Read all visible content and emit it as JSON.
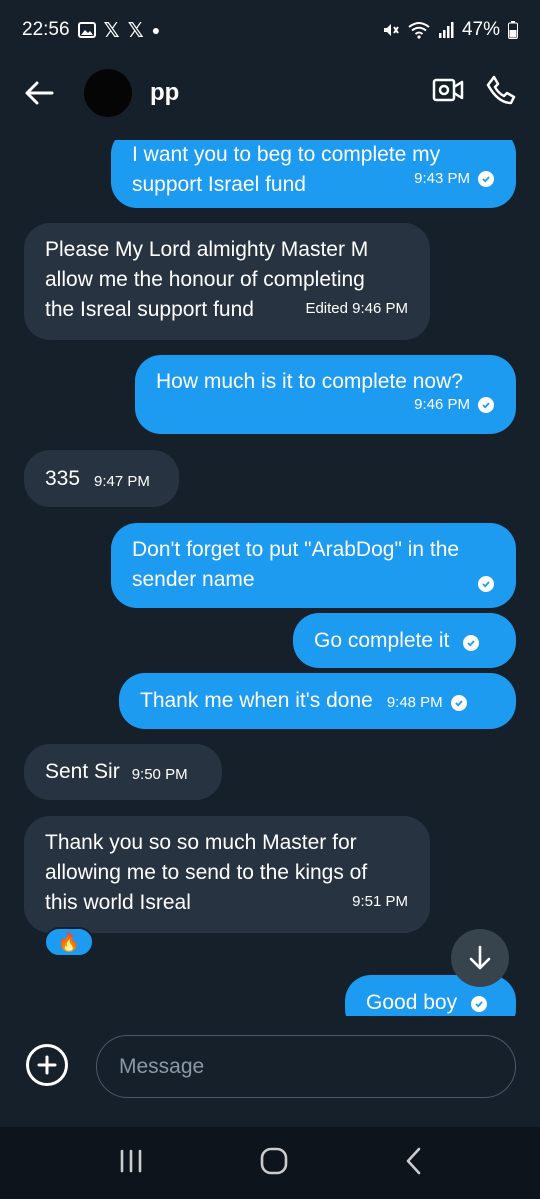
{
  "status_bar": {
    "time": "22:56",
    "battery": "47%",
    "icons": [
      "image-icon",
      "x-logo",
      "x-logo",
      "dot",
      "mute-icon",
      "wifi-icon",
      "signal-icon",
      "battery-icon"
    ]
  },
  "header": {
    "title": "pp",
    "icons": [
      "back-arrow-icon",
      "video-call-icon",
      "phone-icon"
    ]
  },
  "messages": [
    {
      "dir": "out",
      "text_lines": [
        "I want you to beg to complete my",
        "support Israel fund"
      ],
      "time": "9:43 PM",
      "read": true
    },
    {
      "dir": "in",
      "text_lines": [
        "Please My Lord almighty Master M",
        "allow me the honour of completing",
        "the Isreal support fund"
      ],
      "time": "Edited 9:46 PM"
    },
    {
      "dir": "out",
      "text_lines": [
        "How much is it to complete now?"
      ],
      "time": "9:46 PM",
      "read": true
    },
    {
      "dir": "in",
      "text_lines": [
        "335"
      ],
      "time": "9:47 PM"
    },
    {
      "dir": "out",
      "text_lines": [
        "Don't forget to put \"ArabDog\" in the",
        "sender name"
      ],
      "time": "",
      "read": true
    },
    {
      "dir": "out",
      "text_lines": [
        "Go complete it"
      ],
      "time": "",
      "read": true
    },
    {
      "dir": "out",
      "text_lines": [
        "Thank me when it's done"
      ],
      "time": "9:48 PM",
      "read": true
    },
    {
      "dir": "in",
      "text_lines": [
        "Sent Sir"
      ],
      "time": "9:50 PM"
    },
    {
      "dir": "in",
      "text_lines": [
        "Thank you so so much Master for",
        "allowing me to send to the kings of",
        "this world Isreal"
      ],
      "time": "9:51 PM",
      "reaction": "🔥"
    },
    {
      "dir": "out",
      "text_lines": [
        "Good boy"
      ],
      "time": "",
      "read": true
    }
  ],
  "composer": {
    "placeholder": "Message",
    "add_icon": "plus-circle-icon"
  },
  "scroll_button_icon": "arrow-down-icon",
  "nav_bar": {
    "icons": [
      "recent-apps-icon",
      "home-icon",
      "back-icon"
    ]
  },
  "colors": {
    "background": "#15202b",
    "outgoing_bubble": "#1d9bf0",
    "incoming_bubble": "#273340"
  }
}
